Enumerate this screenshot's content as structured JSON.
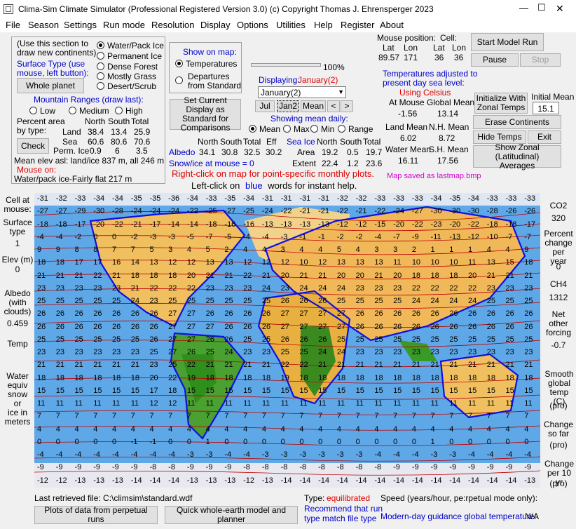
{
  "window": {
    "title": "Clima-Sim Climate Simulator (Professional Registered Version 3.0)    (c) Copyright Thomas J. Ehrensperger 2023",
    "minimize": "—",
    "maximize": "☐",
    "close": "✕"
  },
  "menu": [
    "File",
    "Season",
    "Settings",
    "Run mode",
    "Resolution",
    "Display",
    "Options",
    "Utilities",
    "Help",
    "Register",
    "About"
  ],
  "continents": {
    "hint1": "(Use this section to",
    "hint2": "draw new continents)",
    "surface_type_1": "Surface Type (use",
    "surface_type_2": "mouse, left button):",
    "whole_planet": "Whole planet",
    "types": [
      {
        "label": "Water/Pack Ice",
        "selected": true
      },
      {
        "label": "Permanent Ice",
        "selected": false
      },
      {
        "label": "Dense Forest",
        "selected": false
      },
      {
        "label": "Mostly Grass",
        "selected": false
      },
      {
        "label": "Desert/Scrub",
        "selected": false
      }
    ],
    "mountain_title": "Mountain Ranges (draw last):",
    "mountains": [
      "Low",
      "Medium",
      "High"
    ],
    "percent_area_1": "Percent area",
    "percent_area_2": "by type:",
    "headers": [
      "North",
      "South",
      "Total"
    ],
    "rows": [
      {
        "label": "Land",
        "values": [
          "38.4",
          "13.4",
          "25.9"
        ]
      },
      {
        "label": "Sea",
        "values": [
          "60.6",
          "80.6",
          "70.6"
        ]
      },
      {
        "label": "Perm. Ice",
        "values": [
          "0.9",
          "6",
          "3.5"
        ]
      }
    ],
    "check": "Check",
    "mean_elev": "Mean elev asl: land/ice  837 m, all  246 m",
    "mouse_on": "Mouse on:",
    "mouse_on_value": "Water/pack ice-Fairly flat 217 m"
  },
  "showmap": {
    "title": "Show on map:",
    "temperatures": "Temperatures",
    "departures_1": "Departures",
    "departures_2": "from Standard"
  },
  "progress": {
    "label": "100%"
  },
  "displaying": {
    "label": "Displaying:",
    "value": "January(2)",
    "select": "January(2)",
    "buttons": [
      "Jul",
      "Jan2",
      "Mean",
      "<",
      ">"
    ]
  },
  "set_current": "Set Current Display as Standard for Comparisons",
  "mean_daily": {
    "title": "Showing mean daily:",
    "options": [
      "Mean",
      "Max",
      "Min",
      "Range"
    ]
  },
  "albedo": {
    "headers": [
      "North",
      "South",
      "Total",
      "Eff"
    ],
    "label": "Albedo",
    "values": [
      "34.1",
      "30.8",
      "32.5",
      "30.2"
    ],
    "snow": "Snow/ice at mouse = 0"
  },
  "seaice": {
    "label": "Sea Ice",
    "headers": [
      "North",
      "South",
      "Total"
    ],
    "rows": [
      {
        "label": "Area",
        "values": [
          "19.2",
          "0.5",
          "19.7"
        ]
      },
      {
        "label": "Extent",
        "values": [
          "22.4",
          "1.2",
          "23.6"
        ]
      }
    ]
  },
  "mouse_pos": {
    "title": "Mouse position:",
    "cell": "Cell:",
    "headers": [
      "Lat",
      "Lon",
      "Lat",
      "Lon"
    ],
    "values": [
      "89.57",
      "171",
      "36",
      "36"
    ]
  },
  "temps": {
    "note_1": "Temperatures adjusted to",
    "note_2": "present day sea level:",
    "celsius": "Using Celsius",
    "at_mouse": "At Mouse",
    "global_mean": "Global Mean",
    "at_mouse_val": "-1.56",
    "global_mean_val": "13.14",
    "land_mean": "Land Mean",
    "nh_mean": "N.H. Mean",
    "land_mean_val": "6.02",
    "nh_mean_val": "8.72",
    "water_mean": "Water Mean",
    "sh_mean": "S.H. Mean",
    "water_mean_val": "16.11",
    "sh_mean_val": "17.56"
  },
  "controls": {
    "start": "Start Model Run",
    "pause": "Pause",
    "stop": "Stop",
    "init_1": "Initialize  With",
    "init_2": "Zonal Temps",
    "initial_mean": "Initial Mean",
    "initial_mean_val": "15.1",
    "erase": "Erase Continents",
    "hide": "Hide Temps",
    "exit": "Exit",
    "zonal_1": "Show Zonal (Latitudinal)",
    "zonal_2": "Averages"
  },
  "map_saved": "Map saved as lastmap.bmp",
  "instructions": {
    "right_click": "Right-click on map for point-specific monthly plots.",
    "left_click_a": "Left-click on",
    "left_click_b": "blue",
    "left_click_c": "words for instant help."
  },
  "left_panel": {
    "cell_at_mouse_1": "Cell at",
    "cell_at_mouse_2": "mouse:",
    "surface_1": "Surface",
    "surface_2": "type",
    "surface_val": "1",
    "elev": "Elev (m)",
    "elev_val": "0",
    "albedo_1": "Albedo",
    "albedo_2": "(with",
    "albedo_3": "clouds)",
    "albedo_val": "0.459",
    "temp": "Temp",
    "water_1": "Water",
    "water_2": "equiv",
    "water_3": "snow or",
    "water_4": "ice in",
    "water_5": "meters"
  },
  "right_panel": {
    "co2": "CO2",
    "co2_val": "320",
    "pct_1": "Percent",
    "pct_2": "change",
    "pct_3": "per year",
    "pct_val": "0",
    "ch4": "CH4",
    "ch4_val": "1312",
    "net_1": "Net",
    "net_2": "other",
    "net_3": "forcing",
    "net_val": "-0.7",
    "smooth_1": "Smooth",
    "smooth_2": "global",
    "smooth_3": "temp (C)",
    "smooth_val": "(pro)",
    "change_1": "Change",
    "change_2": "so far",
    "change_val": "(pro)",
    "change10_1": "Change",
    "change10_2": "per 10 yr",
    "change10_val": "(pro)"
  },
  "map_rows": [
    [
      "-31",
      "-32",
      "-33",
      "-34",
      "-34",
      "-35",
      "-35",
      "-36",
      "-34",
      "-33",
      "-35",
      "-34",
      "-31",
      "-31",
      "-31",
      "-31",
      "-32",
      "-32",
      "-33",
      "-33",
      "-33",
      "-34",
      "-35",
      "-34",
      "-33",
      "-33",
      "-33"
    ],
    [
      "-27",
      "-27",
      "-29",
      "-30",
      "-28",
      "-24",
      "-24",
      "-24",
      "-22",
      "-25",
      "-27",
      "-25",
      "-24",
      "-22",
      "-21",
      "-21",
      "-22",
      "-21",
      "-22",
      "-24",
      "-27",
      "-30",
      "-30",
      "-30",
      "-28",
      "-26",
      "-26"
    ],
    [
      "-18",
      "-18",
      "-17",
      "-20",
      "-22",
      "-21",
      "-17",
      "-14",
      "-14",
      "-18",
      "-16",
      "-16",
      "-13",
      "-13",
      "-13",
      "-13",
      "-12",
      "-12",
      "-15",
      "-20",
      "-22",
      "-23",
      "-20",
      "-22",
      "-18",
      "-18",
      "-17"
    ],
    [
      "-4",
      "-4",
      "-2",
      "0",
      "0",
      "-2",
      "-3",
      "-3",
      "-5",
      "-7",
      "-5",
      "-4",
      "-4",
      "-3",
      "-1",
      "-1",
      "-2",
      "-2",
      "-4",
      "-7",
      "-9",
      "-11",
      "-13",
      "-12",
      "-10",
      "-7",
      "-7"
    ],
    [
      "9",
      "9",
      "8",
      "8",
      "7",
      "7",
      "5",
      "3",
      "4",
      "5",
      "2",
      "4",
      "4",
      "3",
      "4",
      "4",
      "5",
      "4",
      "3",
      "3",
      "2",
      "1",
      "1",
      "1",
      "4",
      "4",
      "9"
    ],
    [
      "18",
      "18",
      "17",
      "17",
      "16",
      "14",
      "13",
      "12",
      "12",
      "13",
      "13",
      "12",
      "12",
      "12",
      "10",
      "12",
      "13",
      "13",
      "13",
      "11",
      "10",
      "10",
      "10",
      "11",
      "13",
      "15",
      "18"
    ],
    [
      "21",
      "21",
      "21",
      "22",
      "21",
      "18",
      "18",
      "18",
      "20",
      "21",
      "21",
      "22",
      "21",
      "20",
      "21",
      "21",
      "20",
      "20",
      "21",
      "20",
      "18",
      "18",
      "18",
      "20",
      "21",
      "21",
      "21"
    ],
    [
      "23",
      "23",
      "23",
      "23",
      "23",
      "21",
      "22",
      "22",
      "22",
      "23",
      "23",
      "23",
      "24",
      "23",
      "24",
      "24",
      "24",
      "23",
      "23",
      "23",
      "22",
      "22",
      "22",
      "22",
      "23",
      "23",
      "23"
    ],
    [
      "25",
      "25",
      "25",
      "25",
      "25",
      "24",
      "23",
      "25",
      "25",
      "25",
      "25",
      "25",
      "25",
      "26",
      "26",
      "26",
      "25",
      "25",
      "25",
      "25",
      "24",
      "24",
      "24",
      "24",
      "25",
      "25",
      "25"
    ],
    [
      "26",
      "26",
      "26",
      "26",
      "26",
      "26",
      "26",
      "27",
      "27",
      "26",
      "26",
      "26",
      "26",
      "27",
      "27",
      "27",
      "27",
      "26",
      "26",
      "26",
      "26",
      "26",
      "26",
      "26",
      "26",
      "26",
      "26"
    ],
    [
      "26",
      "26",
      "26",
      "26",
      "26",
      "26",
      "26",
      "27",
      "27",
      "27",
      "26",
      "26",
      "26",
      "27",
      "27",
      "27",
      "27",
      "26",
      "26",
      "26",
      "26",
      "26",
      "26",
      "26",
      "26",
      "26",
      "26"
    ],
    [
      "25",
      "25",
      "25",
      "25",
      "25",
      "25",
      "26",
      "27",
      "27",
      "26",
      "26",
      "25",
      "25",
      "26",
      "26",
      "26",
      "25",
      "25",
      "25",
      "25",
      "25",
      "25",
      "25",
      "25",
      "25",
      "25",
      "25"
    ],
    [
      "23",
      "23",
      "23",
      "23",
      "23",
      "23",
      "25",
      "27",
      "26",
      "25",
      "24",
      "23",
      "23",
      "25",
      "25",
      "24",
      "24",
      "23",
      "23",
      "23",
      "23",
      "23",
      "23",
      "23",
      "23",
      "23",
      "23"
    ],
    [
      "21",
      "21",
      "21",
      "21",
      "21",
      "21",
      "23",
      "25",
      "22",
      "21",
      "21",
      "21",
      "21",
      "22",
      "22",
      "21",
      "21",
      "21",
      "21",
      "21",
      "21",
      "21",
      "21",
      "21",
      "21",
      "21",
      "21"
    ],
    [
      "18",
      "18",
      "18",
      "18",
      "18",
      "18",
      "20",
      "22",
      "19",
      "18",
      "18",
      "18",
      "18",
      "19",
      "18",
      "18",
      "18",
      "18",
      "18",
      "18",
      "18",
      "18",
      "18",
      "18",
      "18",
      "18",
      "18"
    ],
    [
      "15",
      "15",
      "15",
      "15",
      "15",
      "15",
      "17",
      "18",
      "15",
      "15",
      "15",
      "15",
      "15",
      "15",
      "15",
      "15",
      "15",
      "15",
      "15",
      "15",
      "15",
      "15",
      "15",
      "15",
      "15",
      "15",
      "15"
    ],
    [
      "11",
      "11",
      "11",
      "11",
      "11",
      "11",
      "12",
      "12",
      "11",
      "11",
      "11",
      "11",
      "11",
      "11",
      "11",
      "11",
      "11",
      "11",
      "11",
      "11",
      "11",
      "11",
      "11",
      "11",
      "11",
      "11",
      "11"
    ],
    [
      "7",
      "7",
      "7",
      "7",
      "7",
      "7",
      "7",
      "7",
      "7",
      "7",
      "7",
      "7",
      "7",
      "7",
      "7",
      "7",
      "7",
      "7",
      "7",
      "7",
      "7",
      "7",
      "7",
      "7",
      "7",
      "7",
      "7"
    ],
    [
      "4",
      "4",
      "4",
      "4",
      "4",
      "4",
      "4",
      "4",
      "4",
      "4",
      "4",
      "4",
      "4",
      "4",
      "4",
      "4",
      "4",
      "4",
      "4",
      "4",
      "4",
      "4",
      "4",
      "4",
      "4",
      "4",
      "4"
    ],
    [
      "0",
      "0",
      "0",
      "0",
      "0",
      "-1",
      "-1",
      "0",
      "0",
      "1",
      "0",
      "0",
      "0",
      "0",
      "0",
      "0",
      "0",
      "0",
      "0",
      "0",
      "0",
      "1",
      "0",
      "0",
      "0",
      "0",
      "0"
    ],
    [
      "-4",
      "-4",
      "-4",
      "-4",
      "-4",
      "-4",
      "-4",
      "-4",
      "-3",
      "-3",
      "-4",
      "-4",
      "-3",
      "-3",
      "-3",
      "-3",
      "-3",
      "-3",
      "-4",
      "-4",
      "-4",
      "-3",
      "-3",
      "-4",
      "-4",
      "-4",
      "-4"
    ],
    [
      "-9",
      "-9",
      "-9",
      "-9",
      "-9",
      "-9",
      "-8",
      "-8",
      "-9",
      "-9",
      "-9",
      "-8",
      "-8",
      "-8",
      "-8",
      "-8",
      "-8",
      "-8",
      "-8",
      "-9",
      "-9",
      "-9",
      "-9",
      "-9",
      "-9",
      "-9",
      "-9"
    ],
    [
      "-12",
      "-12",
      "-13",
      "-13",
      "-13",
      "-14",
      "-14",
      "-14",
      "-13",
      "-13",
      "-13",
      "-12",
      "-13",
      "-14",
      "-14",
      "-14",
      "-14",
      "-14",
      "-14",
      "-14",
      "-14",
      "-14",
      "-14",
      "-14",
      "-14",
      "-14",
      "-13"
    ]
  ],
  "bottom": {
    "last_retrieved": "Last retrieved file:   C:\\climsim\\standard.wdf",
    "type": "Type:",
    "type_val": "equilibrated",
    "recommend_1": "Recommend that run",
    "recommend_2": "type match file type",
    "speed": "Speed (years/hour, pe:rpetual mode only):",
    "plots": "Plots of data from perpetual runs",
    "quick": "Quick whole-earth model and planner",
    "modern": "Modern-day guidance global temperature:",
    "modern_val": "N/A"
  }
}
